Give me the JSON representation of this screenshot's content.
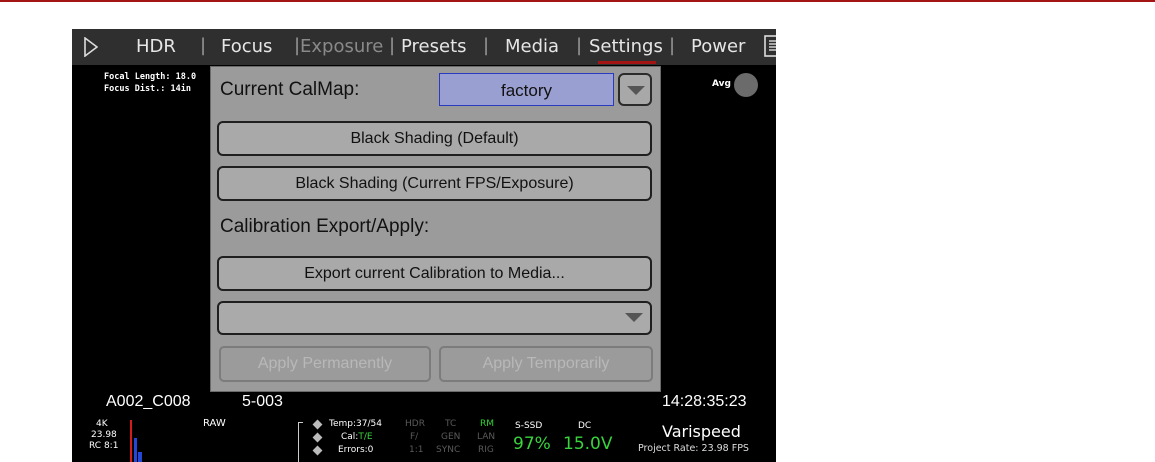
{
  "menu": {
    "items": [
      {
        "label": "HDR",
        "state": "normal"
      },
      {
        "label": "Focus",
        "state": "normal"
      },
      {
        "label": "Exposure",
        "state": "disabled"
      },
      {
        "label": "Presets",
        "state": "normal"
      },
      {
        "label": "Media",
        "state": "normal"
      },
      {
        "label": "Settings",
        "state": "active"
      },
      {
        "label": "Power",
        "state": "normal"
      }
    ],
    "active_color": "#a31515"
  },
  "lens": {
    "focal_length": "Focal Length: 18.0",
    "focus_dist": "Focus Dist.: 14in"
  },
  "meter": {
    "label": "Avg"
  },
  "dialog": {
    "current_calmap_label": "Current CalMap:",
    "calmap_value": "factory",
    "black_shading_default": "Black Shading (Default)",
    "black_shading_current": "Black Shading (Current FPS/Exposure)",
    "export_apply_label": "Calibration Export/Apply:",
    "export_button": "Export current Calibration to Media...",
    "apply_select_value": "",
    "apply_permanently": "Apply Permanently",
    "apply_temporarily": "Apply Temporarily"
  },
  "clip": {
    "name": "A002_C008",
    "take": "5-003",
    "timecode": "14:28:35:23"
  },
  "status": {
    "resolution": "4K",
    "fps": "23.98",
    "compression": "RC 8:1",
    "format": "RAW",
    "temp": "Temp:37/54",
    "cal_prefix": "Cal:",
    "cal_value": "T/E",
    "errors": "Errors:0",
    "col1": [
      "HDR",
      "F/",
      "1:1"
    ],
    "col2": [
      "TC",
      "GEN",
      "SYNC"
    ],
    "col3": [
      "RM",
      "LAN",
      "RIG"
    ],
    "media_label": "S-SSD",
    "media_value": "97%",
    "power_label": "DC",
    "power_value": "15.0V",
    "varispeed": "Varispeed",
    "project_rate": "Project Rate: 23.98 FPS"
  }
}
